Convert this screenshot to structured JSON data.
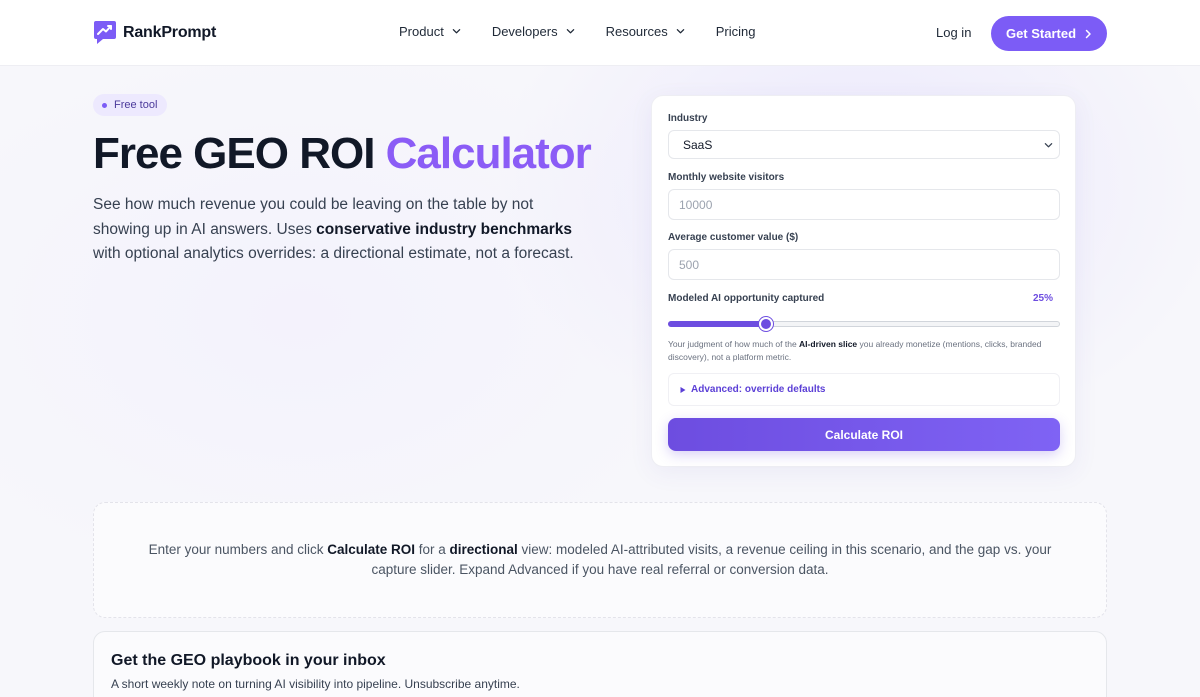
{
  "brand": {
    "name": "RankPrompt",
    "accent": "#7c5cf6"
  },
  "nav": {
    "items": [
      {
        "label": "Product",
        "has_dropdown": true
      },
      {
        "label": "Developers",
        "has_dropdown": true
      },
      {
        "label": "Resources",
        "has_dropdown": true
      },
      {
        "label": "Pricing",
        "has_dropdown": false
      }
    ],
    "login": "Log in",
    "cta": "Get Started"
  },
  "hero": {
    "badge": "Free tool",
    "title_main": "Free GEO ROI ",
    "title_accent": "Calculator",
    "desc_1": "See how much revenue you could be leaving on the table by not showing up in AI answers. Uses ",
    "desc_bold": "conservative industry benchmarks",
    "desc_2": " with optional analytics overrides: a directional estimate, not a forecast."
  },
  "calculator": {
    "industry_label": "Industry",
    "industry_value": "SaaS",
    "visitors_label": "Monthly website visitors",
    "visitors_placeholder": "10000",
    "customer_value_label": "Average customer value ($)",
    "customer_value_placeholder": "500",
    "opportunity_label": "Modeled AI opportunity captured",
    "opportunity_value_text": "25%",
    "opportunity_value": 25,
    "hint_1": "Your judgment of how much of the ",
    "hint_bold": "AI-driven slice",
    "hint_2": " you already monetize (mentions, clicks, branded discovery), not a platform metric.",
    "advanced_label": "Advanced: override defaults",
    "calculate_label": "Calculate ROI"
  },
  "results": {
    "text_1": "Enter your numbers and click ",
    "bold_1": "Calculate ROI",
    "text_2": " for a ",
    "bold_2": "directional",
    "text_3": " view: modeled AI-attributed visits, a revenue ceiling in this scenario, and the gap vs. your capture slider. Expand Advanced if you have real referral or conversion data."
  },
  "newsletter": {
    "title": "Get the GEO playbook in your inbox",
    "subtitle": "A short weekly note on turning AI visibility into pipeline. Unsubscribe anytime."
  }
}
